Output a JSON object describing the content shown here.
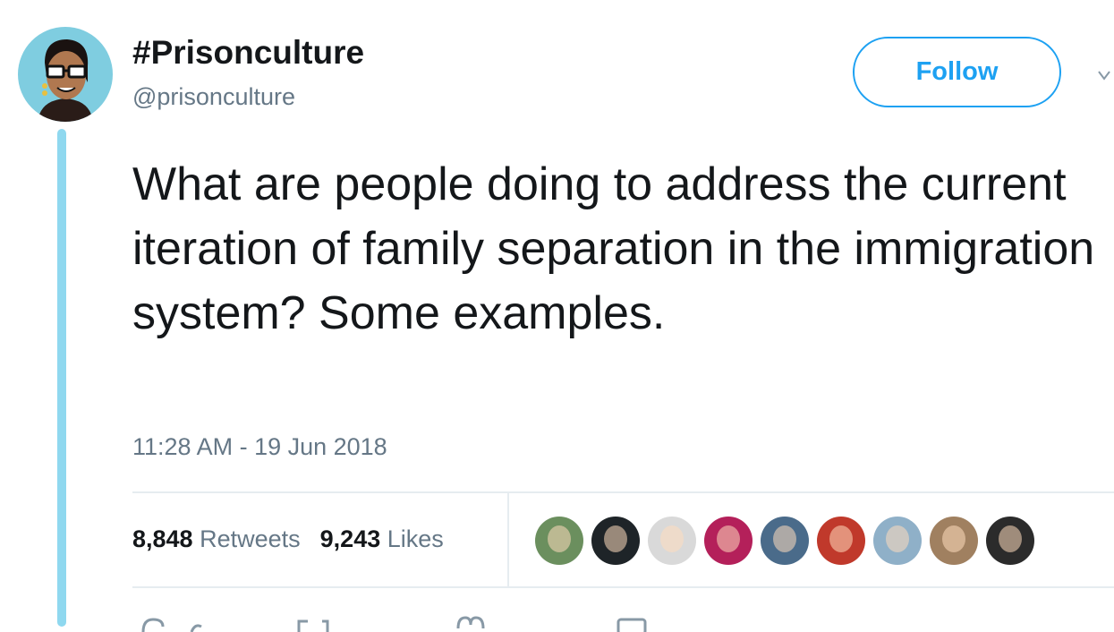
{
  "tweet": {
    "display_name": "#Prisonculture",
    "handle": "@prisonculture",
    "text": "What are people doing to address the current iteration of family separation in the immigration system? Some examples.",
    "timestamp": "11:28 AM - 19 Jun 2018",
    "follow_label": "Follow",
    "retweets_count": "8,848",
    "retweets_label": "Retweets",
    "likes_count": "9,243",
    "likes_label": "Likes"
  },
  "likers": [
    {
      "name": "liker-avatar-1",
      "color": "#6b8f5e"
    },
    {
      "name": "liker-avatar-2",
      "color": "#1e2428"
    },
    {
      "name": "liker-avatar-3",
      "color": "#d9d9d9"
    },
    {
      "name": "liker-avatar-4",
      "color": "#b4205a"
    },
    {
      "name": "liker-avatar-5",
      "color": "#4a6b8a"
    },
    {
      "name": "liker-avatar-6",
      "color": "#c0392b"
    },
    {
      "name": "liker-avatar-7",
      "color": "#8fb0c8"
    },
    {
      "name": "liker-avatar-8",
      "color": "#a08060"
    },
    {
      "name": "liker-avatar-9",
      "color": "#2b2b2b"
    }
  ],
  "icons": [
    "reply-icon",
    "retweet-icon",
    "like-icon",
    "message-icon",
    "chevron-down-icon"
  ],
  "colors": {
    "accent": "#1da1f2",
    "thread_line": "#8fd8ef",
    "secondary_text": "#657786",
    "avatar_bg": "#7fcde0"
  }
}
